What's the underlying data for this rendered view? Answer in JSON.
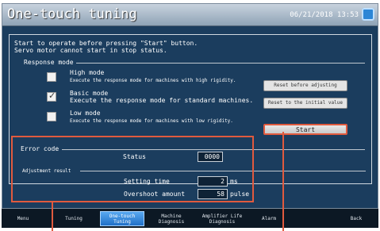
{
  "title": "One-touch tuning",
  "datetime": "06/21/2018 13:53",
  "intro_line1": "Start to operate before pressing \"Start\" button.",
  "intro_line2": "Servo motor cannot start in stop status.",
  "response_mode": {
    "label": "Response mode",
    "options": [
      {
        "name": "High mode",
        "desc": "Execute the response mode for machines with high rigidity.",
        "checked": false
      },
      {
        "name": "Basic mode",
        "desc": "Execute the response mode for standard machines.",
        "checked": true
      },
      {
        "name": "Low mode",
        "desc": "Execute the response mode for machines with low rigidity.",
        "checked": false
      }
    ]
  },
  "buttons": {
    "reset_before": "Reset before adjusting",
    "reset_initial": "Reset to the initial value",
    "start": "Start"
  },
  "error": {
    "label": "Error code",
    "status_label": "Status",
    "status_value": "0000"
  },
  "adjustment": {
    "label": "Adjustment result",
    "settling_label": "Setting time",
    "settling_value": "2",
    "settling_unit": "ms",
    "overshoot_label": "Overshoot amount",
    "overshoot_value": "58",
    "overshoot_unit": "pulse"
  },
  "tabs": [
    {
      "label": "Menu",
      "active": false
    },
    {
      "label": "Tuning",
      "active": false
    },
    {
      "label": "One-touch\nTuning",
      "active": true
    },
    {
      "label": "Machine\nDiagnosis",
      "active": false
    },
    {
      "label": "Amplifier Life\nDiagnosis",
      "active": false
    },
    {
      "label": "Alarm",
      "active": false
    },
    {
      "label": "",
      "active": false
    },
    {
      "label": "Back",
      "active": false
    }
  ],
  "colors": {
    "highlight": "#e05a3e",
    "background": "#1b3d5e",
    "active_tab": "#2070c8"
  }
}
